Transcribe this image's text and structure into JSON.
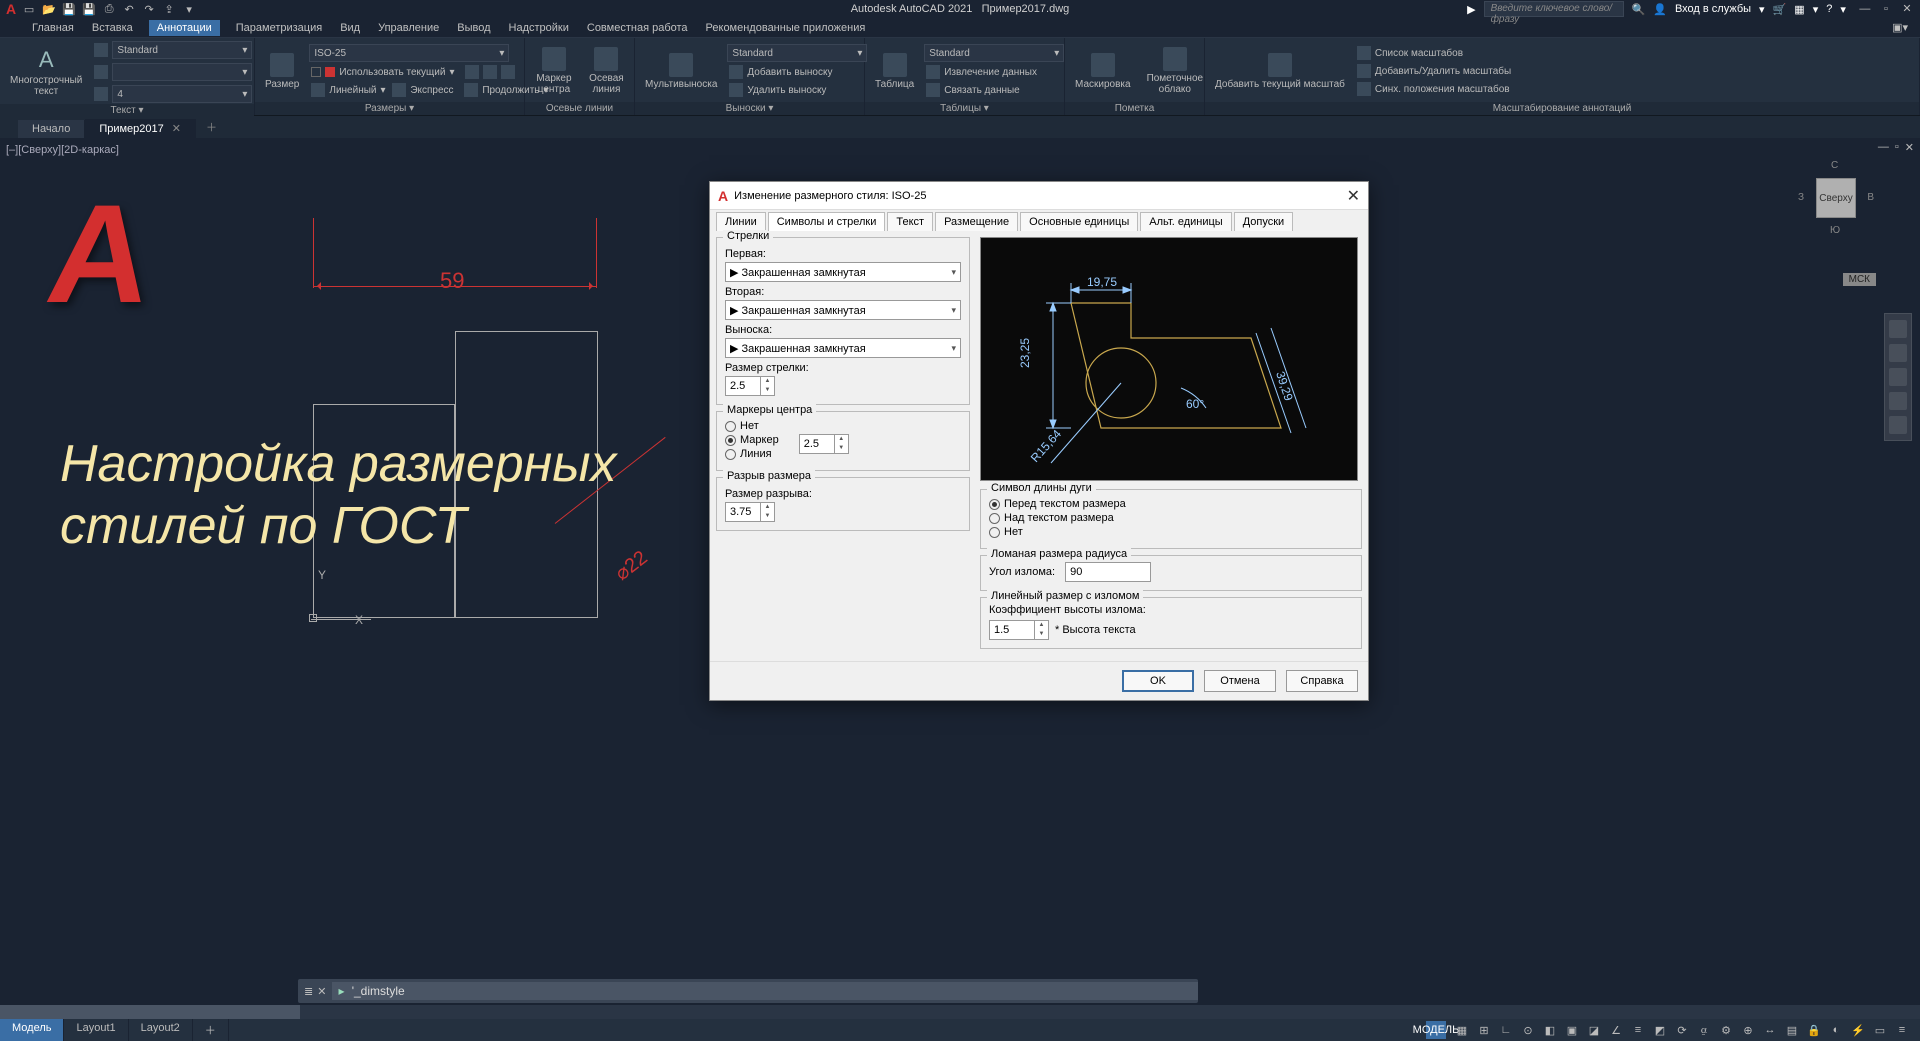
{
  "app": {
    "title_product": "Autodesk AutoCAD 2021",
    "title_file": "Пример2017.dwg"
  },
  "titlebar": {
    "search_placeholder": "Введите ключевое слово/фразу",
    "signin": "Вход в службы"
  },
  "menutabs": [
    "Главная",
    "Вставка",
    "Аннотации",
    "Параметризация",
    "Вид",
    "Управление",
    "Вывод",
    "Надстройки",
    "Совместная работа",
    "Рекомендованные приложения"
  ],
  "menutabs_active_index": 2,
  "ribbon": {
    "text_panel": {
      "title": "Текст",
      "btn": "Многострочный\nтекст",
      "style": "Standard",
      "height": "4"
    },
    "dim_panel": {
      "title": "Размеры",
      "btn": "Размер",
      "style": "ISO-25",
      "use_current": "Использовать текущий",
      "linear": "Линейный",
      "express": "Экспресс",
      "continue": "Продолжить"
    },
    "centerlines_panel": {
      "title": "Осевые линии",
      "marker": "Маркер центра",
      "axial": "Осевая линия"
    },
    "leaders_panel": {
      "title": "Выноски",
      "btn": "Мультивыноска",
      "style": "Standard",
      "add": "Добавить выноску",
      "remove": "Удалить выноску"
    },
    "tables_panel": {
      "title": "Таблицы",
      "btn": "Таблица",
      "style": "Standard",
      "extract": "Извлечение данных",
      "link": "Связать данные"
    },
    "markup_panel": {
      "title": "Пометка",
      "mask": "Маскировка",
      "cloud": "Пометочное облако"
    },
    "scale_panel": {
      "title": "Масштабирование аннотаций",
      "btn": "Добавить текущий масштаб",
      "list": "Список масштабов",
      "addrem": "Добавить/Удалить масштабы",
      "sync": "Синх. положения масштабов"
    }
  },
  "doctabs": {
    "start": "Начало",
    "file": "Пример2017"
  },
  "view_label": "[–][Сверху][2D-каркас]",
  "viewcube": {
    "top": "Сверху",
    "n": "С",
    "s": "Ю",
    "e": "В",
    "w": "З",
    "badge": "МСК"
  },
  "overlay_text_l1": "Настройка размерных",
  "overlay_text_l2": "стилей по ГОСТ",
  "dim59": "59",
  "dim_phi22": "⌀22",
  "ucs": {
    "x": "X",
    "y": "Y"
  },
  "dialog": {
    "title": "Изменение размерного стиля: ISO-25",
    "tabs": [
      "Линии",
      "Символы и стрелки",
      "Текст",
      "Размещение",
      "Основные единицы",
      "Альт. единицы",
      "Допуски"
    ],
    "active_tab_index": 1,
    "arrows": {
      "group": "Стрелки",
      "first_label": "Первая:",
      "first_value": "Закрашенная замкнутая",
      "second_label": "Вторая:",
      "second_value": "Закрашенная замкнутая",
      "leader_label": "Выноска:",
      "leader_value": "Закрашенная замкнутая",
      "size_label": "Размер стрелки:",
      "size_value": "2.5"
    },
    "center": {
      "group": "Маркеры центра",
      "none": "Нет",
      "marker": "Маркер",
      "line": "Линия",
      "value": "2.5"
    },
    "break": {
      "group": "Разрыв размера",
      "label": "Размер разрыва:",
      "value": "3.75"
    },
    "arc": {
      "group": "Символ длины дуги",
      "before": "Перед текстом размера",
      "above": "Над текстом размера",
      "none": "Нет"
    },
    "jog_radius": {
      "group": "Ломаная размера радиуса",
      "angle_label": "Угол излома:",
      "angle_value": "90"
    },
    "jog_linear": {
      "group": "Линейный размер с изломом",
      "factor_label": "Коэффициент высоты излома:",
      "factor_value": "1.5",
      "text_height": "* Высота текста"
    },
    "preview": {
      "d1": "19,75",
      "d2": "23,25",
      "d3": "39,29",
      "angle": "60°",
      "radius": "R15,64"
    },
    "buttons": {
      "ok": "OK",
      "cancel": "Отмена",
      "help": "Справка"
    }
  },
  "command": {
    "text": "'_dimstyle",
    "prompt": "▸"
  },
  "statusbar": {
    "model": "Модель",
    "layout1": "Layout1",
    "layout2": "Layout2",
    "model_label": "МОДЕЛЬ"
  }
}
